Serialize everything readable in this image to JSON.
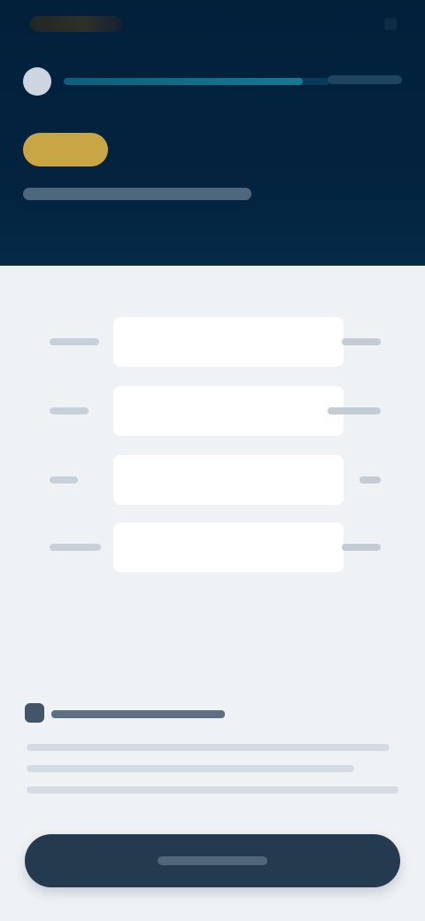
{
  "theme": {
    "header_bg": "#02203a",
    "accent_badge": "#c9a645",
    "progress_fill": "#137a92",
    "button_bg": "#243a4f",
    "page_bg": "#eef2f5"
  },
  "status_bar": {
    "carrier": "",
    "icon": "battery-icon"
  },
  "progress": {
    "avatar_icon": "avatar-icon",
    "fraction": 0.9,
    "label": ""
  },
  "header": {
    "badge": "",
    "title": ""
  },
  "form": {
    "fields": [
      {
        "label": "",
        "value": "",
        "placeholder": ""
      },
      {
        "label": "",
        "value": "",
        "placeholder": ""
      },
      {
        "label": "",
        "value": "",
        "placeholder": ""
      },
      {
        "label": "",
        "value": "",
        "placeholder": ""
      }
    ]
  },
  "consent": {
    "icon": "info-icon",
    "title": "",
    "text": ""
  },
  "primary_action": {
    "label": ""
  }
}
